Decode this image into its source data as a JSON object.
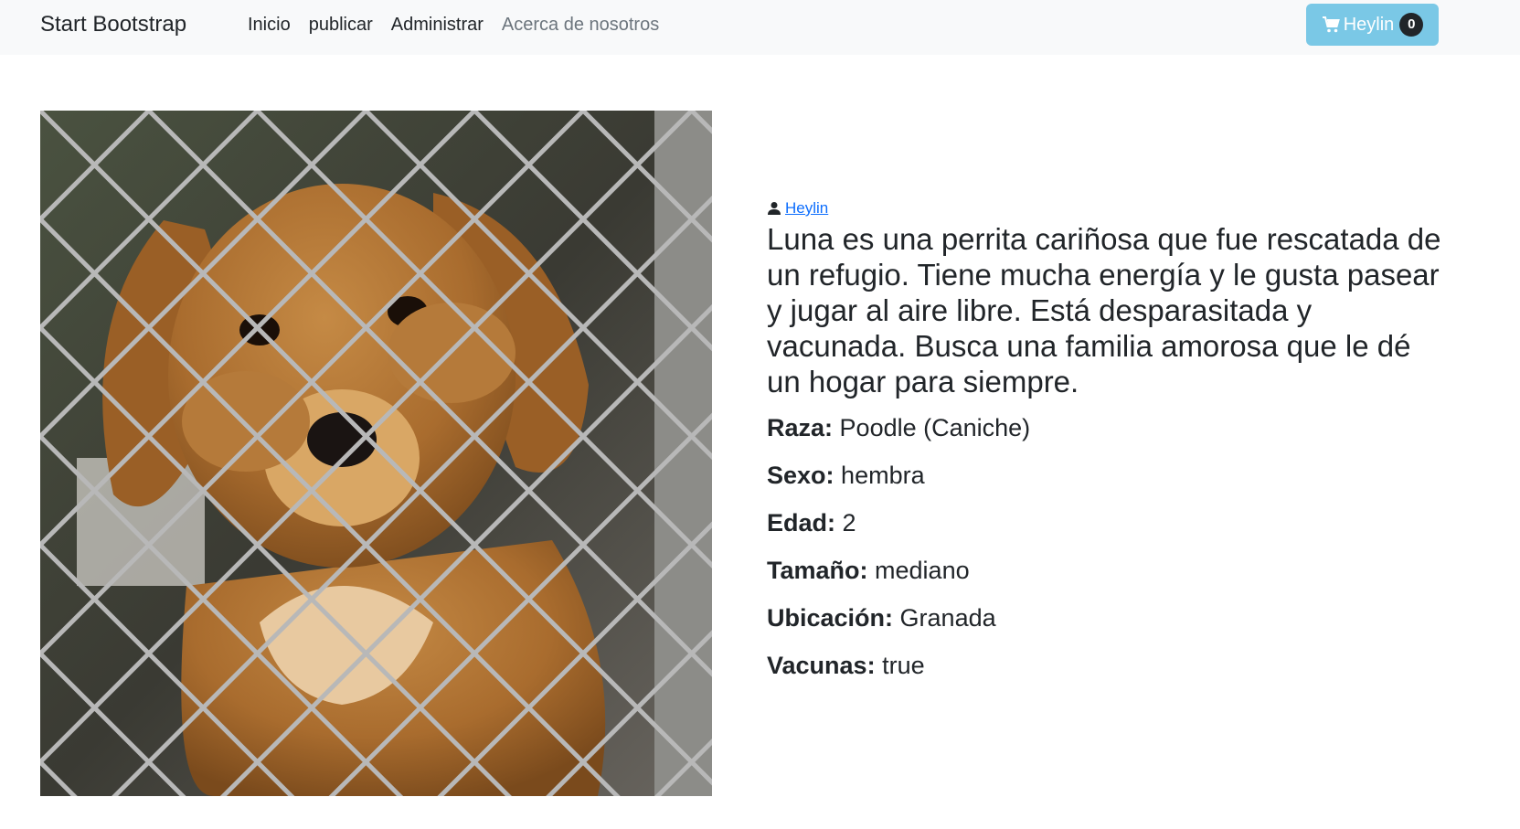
{
  "navbar": {
    "brand": "Start Bootstrap",
    "links": [
      {
        "label": "Inicio"
      },
      {
        "label": "publicar"
      },
      {
        "label": "Administrar"
      },
      {
        "label": "Acerca de nosotros"
      }
    ],
    "cart": {
      "icon": "cart-icon",
      "label": "Heylin",
      "count": "0"
    }
  },
  "pet": {
    "author": {
      "icon": "person-icon",
      "name": "Heylin"
    },
    "description": "Luna es una perrita cariñosa que fue rescatada de un refugio. Tiene mucha energía y le gusta pasear y jugar al aire libre. Está desparasitada y vacunada. Busca una familia amorosa que le dé un hogar para siempre.",
    "attributes": [
      {
        "label": "Raza:",
        "value": "Poodle (Caniche)"
      },
      {
        "label": "Sexo:",
        "value": "hembra"
      },
      {
        "label": "Edad:",
        "value": "2"
      },
      {
        "label": "Tamaño:",
        "value": "mediano"
      },
      {
        "label": "Ubicación:",
        "value": "Granada"
      },
      {
        "label": "Vacunas:",
        "value": "true"
      }
    ]
  },
  "colors": {
    "navbar_bg": "#f8f9fa",
    "cart_button": "#7ac8e6",
    "link": "#0d6efd"
  }
}
